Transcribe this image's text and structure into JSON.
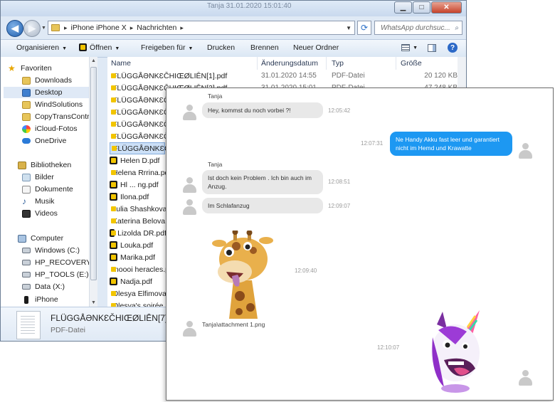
{
  "explorer": {
    "window_title": "Tanja 31.01.2020 15:01:40",
    "breadcrumbs": [
      "iPhone iPhone X",
      "Nachrichten"
    ],
    "search_placeholder": "WhatsApp durchsuc...",
    "toolbar": {
      "organize": "Organisieren",
      "open": "Öffnen",
      "share": "Freigeben für",
      "print": "Drucken",
      "burn": "Brennen",
      "new_folder": "Neuer Ordner"
    },
    "nav": {
      "favorites_header": "Favoriten",
      "favorites": [
        "Downloads",
        "Desktop",
        "WindSolutions",
        "CopyTransControl",
        "iCloud-Fotos",
        "OneDrive"
      ],
      "libraries_header": "Bibliotheken",
      "libraries": [
        "Bilder",
        "Dokumente",
        "Musik",
        "Videos"
      ],
      "computer_header": "Computer",
      "computer": [
        "Windows (C:)",
        "HP_RECOVERY (D:)",
        "HP_TOOLS (E:)",
        "Data (X:)",
        "iPhone"
      ]
    },
    "columns": {
      "name": "Name",
      "date": "Änderungsdatum",
      "type": "Typ",
      "size": "Größe"
    },
    "files": [
      {
        "name": "FLÜGGÅƏNKƐČHIŒØLIĒN[1].pdf",
        "date": "31.01.2020 14:55",
        "type": "PDF-Datei",
        "size": "20 120 KB"
      },
      {
        "name": "FLÜGGÅƏNKƐČHIŒØLIĒN[2].pdf",
        "date": "31.01.2020 15:01",
        "type": "PDF-Datei",
        "size": "47 248 KB"
      },
      {
        "name": "FLÜGGÅƏNKƐČHIŒØLIĒN[3].pdf",
        "date": "",
        "type": "",
        "size": ""
      },
      {
        "name": "FLÜGGÅƏNKƐČHIŒØLIĒN[4].pdf",
        "date": "",
        "type": "",
        "size": ""
      },
      {
        "name": "FLÜGGÅƏNKƐČHIŒØLIĒN[5].pdf",
        "date": "",
        "type": "",
        "size": ""
      },
      {
        "name": "FLÜGGÅƏNKƐČHIŒØLIĒN[6].pdf",
        "date": "",
        "type": "",
        "size": ""
      },
      {
        "name": "FLÜGGÅƏNKƐČHIŒØLIĒN[7].pdf",
        "date": "",
        "type": "",
        "size": ""
      },
      {
        "name": "Helen D.pdf",
        "date": "",
        "type": "",
        "size": ""
      },
      {
        "name": "Helena Rrrina.pdf",
        "date": "",
        "type": "",
        "size": ""
      },
      {
        "name": "Hl ... ng.pdf",
        "date": "",
        "type": "",
        "size": ""
      },
      {
        "name": "Ilona.pdf",
        "date": "",
        "type": "",
        "size": ""
      },
      {
        "name": "Julia Shashkova.pdf",
        "date": "",
        "type": "",
        "size": ""
      },
      {
        "name": "Katerina Belova.pdf",
        "date": "",
        "type": "",
        "size": ""
      },
      {
        "name": "Lizolda DR.pdf",
        "date": "",
        "type": "",
        "size": ""
      },
      {
        "name": "Louka.pdf",
        "date": "",
        "type": "",
        "size": ""
      },
      {
        "name": "Marika.pdf",
        "date": "",
        "type": "",
        "size": ""
      },
      {
        "name": "moooi heracles.pdf",
        "date": "",
        "type": "",
        "size": ""
      },
      {
        "name": "Nadja.pdf",
        "date": "",
        "type": "",
        "size": ""
      },
      {
        "name": "Olesya Elfimova.pdf",
        "date": "",
        "type": "",
        "size": ""
      },
      {
        "name": "Olesya's soirée.pdf",
        "date": "",
        "type": "",
        "size": ""
      }
    ],
    "details": {
      "name": "FLÜGGÅƏNKƐČHIŒØLIĒN[7].pdf",
      "type": "PDF-Datei"
    }
  },
  "chat": {
    "messages": [
      {
        "dir": "in",
        "sender": "Tanja",
        "text": "Hey, kommst du noch vorbei ?!",
        "time": "12:05:42"
      },
      {
        "dir": "out",
        "sender": "",
        "text": "Ne Handy Akku fast leer und garantiert nicht im Hemd und Krawatte",
        "time": "12:07:31"
      },
      {
        "dir": "in",
        "sender": "Tanja",
        "text": "Ist doch kein Problem . Ich bin auch im Anzug.",
        "time": "12:08:51"
      },
      {
        "dir": "in",
        "sender": "",
        "text": "Im Schlafanzug",
        "time": "12:09:07"
      },
      {
        "dir": "in",
        "sender": "",
        "text": "",
        "time": "12:09:40"
      },
      {
        "dir": "in",
        "sender": "",
        "text": "Tanja\\attachment 1.png",
        "time": ""
      },
      {
        "dir": "out",
        "sender": "",
        "text": "",
        "time": "12:10:07"
      }
    ]
  }
}
